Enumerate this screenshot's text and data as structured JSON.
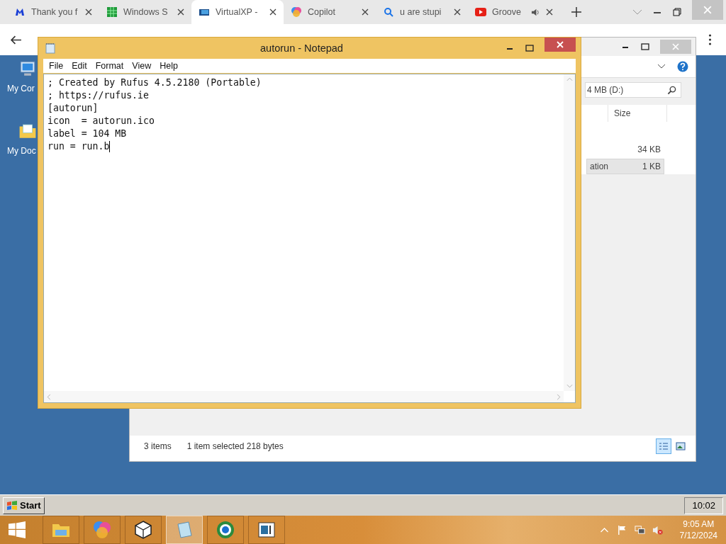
{
  "browser": {
    "tabs": [
      {
        "title": "Thank you f",
        "kind": "m-logo",
        "selected": false,
        "audio": false
      },
      {
        "title": "Windows S",
        "kind": "grid",
        "selected": false,
        "audio": false
      },
      {
        "title": "VirtualXP -",
        "kind": "vm",
        "selected": true,
        "audio": false
      },
      {
        "title": "Copilot",
        "kind": "copilot",
        "selected": false,
        "audio": false
      },
      {
        "title": "u are stupi",
        "kind": "search",
        "selected": false,
        "audio": false
      },
      {
        "title": "Groove",
        "kind": "video",
        "selected": false,
        "audio": true
      }
    ]
  },
  "desktop_icons": [
    {
      "label": "My Cor",
      "kind": "computer"
    },
    {
      "label": "My Doc",
      "kind": "documents"
    }
  ],
  "explorer": {
    "search": {
      "value": "4 MB (D:)"
    },
    "columns": [
      "Size"
    ],
    "rows": [
      {
        "name": "",
        "size": "34 KB",
        "selected": false
      },
      {
        "name": "ation",
        "size": "1 KB",
        "selected": true
      }
    ],
    "status_bar": {
      "items": "3 items",
      "selection": "1 item selected  218 bytes"
    }
  },
  "notepad": {
    "title": "autorun - Notepad",
    "menu": [
      "File",
      "Edit",
      "Format",
      "View",
      "Help"
    ],
    "lines": [
      "; Created by Rufus 4.5.2180 (Portable)",
      "; https://rufus.ie",
      "[autorun]",
      "icon  = autorun.ico",
      "label = 104 MB",
      "run = run.b"
    ]
  },
  "xp_taskbar": {
    "start": "Start",
    "clock": "10:02"
  },
  "taskbar": {
    "apps": [
      {
        "kind": "folder",
        "selected": false
      },
      {
        "kind": "copilot",
        "selected": false
      },
      {
        "kind": "cube",
        "selected": false
      },
      {
        "kind": "notepad",
        "selected": true
      },
      {
        "kind": "globe",
        "selected": false
      },
      {
        "kind": "window",
        "selected": false
      }
    ],
    "time": "9:05 AM",
    "date": "7/12/2024"
  }
}
